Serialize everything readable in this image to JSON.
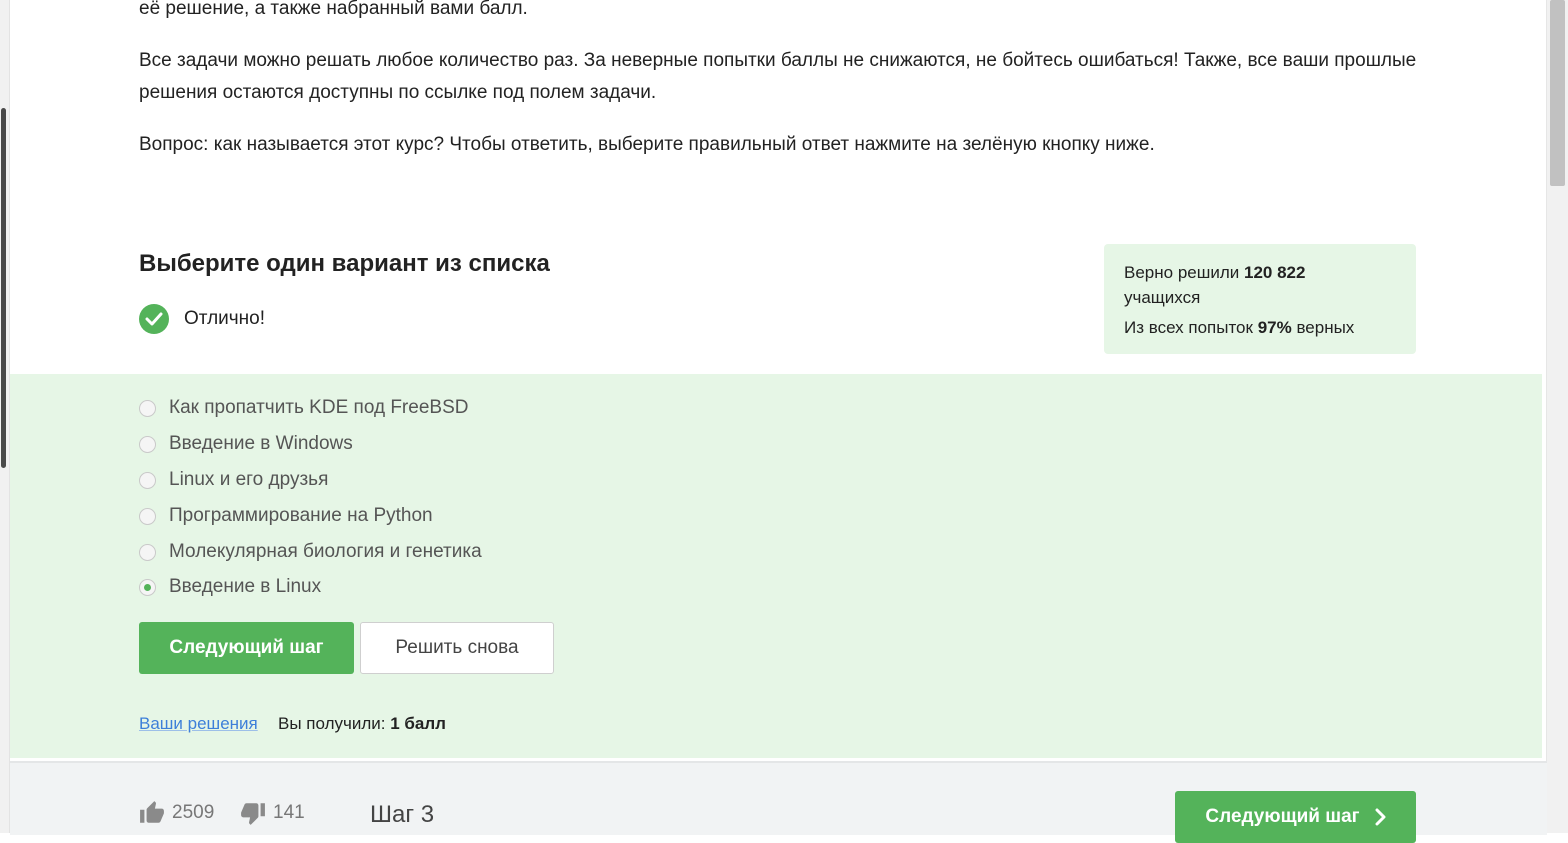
{
  "intro": {
    "p0": "её решение, а также набранный вами балл.",
    "p1": "Все задачи можно решать любое количество раз. За неверные попытки баллы не снижаются, не бойтесь ошибаться! Также, все ваши прошлые решения остаются доступны по ссылке под полем задачи.",
    "p2": "Вопрос: как называется этот курс? Чтобы ответить, выберите правильный ответ нажмите на зелёную кнопку ниже."
  },
  "quiz": {
    "title": "Выберите один вариант из списка",
    "status": "Отлично!",
    "options": [
      {
        "label": "Как пропатчить KDE под FreeBSD",
        "checked": false
      },
      {
        "label": "Введение в Windows",
        "checked": false
      },
      {
        "label": "Linux и его друзья",
        "checked": false
      },
      {
        "label": "Программирование на Python",
        "checked": false
      },
      {
        "label": "Молекулярная биология и генетика",
        "checked": false
      },
      {
        "label": "Введение в Linux",
        "checked": true
      }
    ],
    "next_label": "Следующий шаг",
    "retry_label": "Решить снова",
    "solutions_link": "Ваши решения",
    "score_prefix": "Вы получили:",
    "score_value": "1 балл"
  },
  "stats": {
    "solved_prefix": "Верно решили",
    "solved_count": "120 822",
    "solved_suffix": "учащихся",
    "attempts_prefix": "Из всех попыток",
    "attempts_percent": "97%",
    "attempts_suffix": "верных"
  },
  "footer": {
    "likes": "2509",
    "dislikes": "141",
    "step": "Шаг 3",
    "next_label": "Следующий шаг"
  },
  "colors": {
    "accent_green": "#54b35a",
    "success_bg": "#e6f6e6",
    "link_blue": "#3d7fd9"
  },
  "icons": [
    "check-icon",
    "thumbs-up-icon",
    "thumbs-down-icon",
    "chevron-right-icon"
  ]
}
